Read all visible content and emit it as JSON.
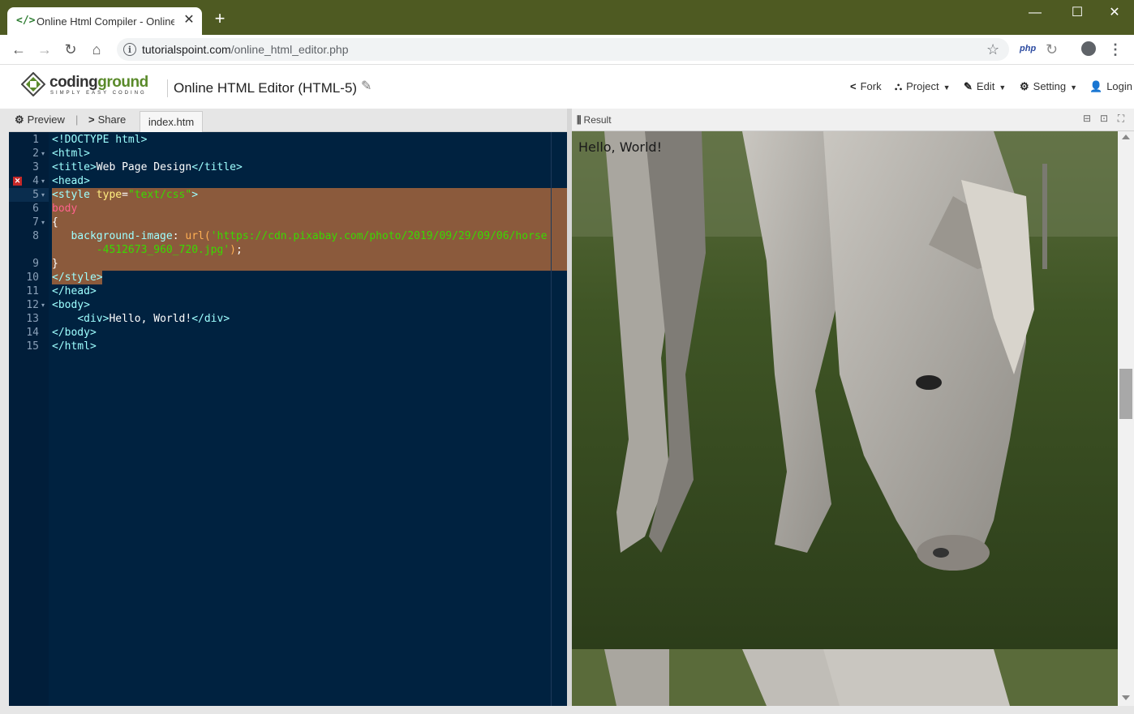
{
  "browser": {
    "tab_title": "Online Html Compiler - Online H",
    "tab_favicon": "</>",
    "tab_close": "✕",
    "new_tab": "+",
    "window_controls": {
      "minimize": "—",
      "maximize": "☐",
      "close": "✕"
    },
    "url_host": "tutorialspoint.com",
    "url_path": "/online_html_editor.php",
    "extension_php": "php"
  },
  "app": {
    "logo_text_a": "coding",
    "logo_text_b": "ground",
    "logo_tagline": "SIMPLY EASY CODING",
    "editor_title": "Online HTML Editor (HTML-5)",
    "nav": {
      "fork": "Fork",
      "project": "Project",
      "edit": "Edit",
      "setting": "Setting",
      "login": "Login"
    }
  },
  "left_pane": {
    "preview": "Preview",
    "separator": "|",
    "share": "Share",
    "file_tab": "index.htm"
  },
  "editor": {
    "line_numbers": [
      "1",
      "2",
      "3",
      "4",
      "5",
      "6",
      "7",
      "8",
      "9",
      "10",
      "11",
      "12",
      "13",
      "14",
      "15"
    ],
    "fold_markers": [
      "2",
      "4",
      "5",
      "7",
      "12"
    ],
    "error_line": "4"
  },
  "right_pane": {
    "result_label": "Result",
    "output_text": "Hello, World!"
  },
  "colors": {
    "chrome_frame": "#4e5a22",
    "editor_bg": "#002240",
    "selection": "#8b5a3c",
    "logo_accent": "#5a8a2a"
  },
  "icons": [
    "code-icon",
    "back-icon",
    "forward-icon",
    "reload-icon",
    "home-icon",
    "info-icon",
    "star-icon",
    "profile-icon",
    "menu-icon",
    "fork-icon",
    "project-icon",
    "edit-icon",
    "gear-icon",
    "user-icon",
    "share-icon",
    "chart-icon",
    "error-icon"
  ]
}
